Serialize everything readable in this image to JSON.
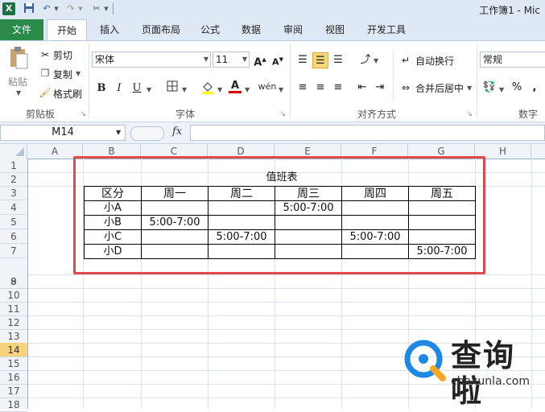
{
  "title_bar": {
    "window_title": "工作簿1 - Mic"
  },
  "tabs": [
    {
      "label": "文件"
    },
    {
      "label": "开始"
    },
    {
      "label": "插入"
    },
    {
      "label": "页面布局"
    },
    {
      "label": "公式"
    },
    {
      "label": "数据"
    },
    {
      "label": "审阅"
    },
    {
      "label": "视图"
    },
    {
      "label": "开发工具"
    }
  ],
  "ribbon": {
    "clipboard": {
      "paste": "粘贴",
      "cut": "剪切",
      "copy": "复制",
      "format_painter": "格式刷",
      "group_label": "剪贴板"
    },
    "font": {
      "font_name": "宋体",
      "font_size": "11",
      "bold": "B",
      "italic": "I",
      "underline": "U",
      "font_color_glyph": "A",
      "phonetic_glyph": "wén",
      "group_label": "字体"
    },
    "alignment": {
      "wrap_text": "自动换行",
      "merge_center": "合并后居中",
      "group_label": "对齐方式"
    },
    "number": {
      "format": "常规",
      "percent": "%",
      "comma": ",",
      "group_label": "数字"
    }
  },
  "formula_bar": {
    "name_box": "M14",
    "fx": "fx",
    "formula": ""
  },
  "sheet": {
    "columns": [
      "A",
      "B",
      "C",
      "D",
      "E",
      "F",
      "G",
      "H"
    ],
    "rows": [
      "1",
      "2",
      "3",
      "4",
      "5",
      "6",
      "7",
      "8",
      "9",
      "10",
      "11",
      "12",
      "13",
      "14",
      "15",
      "16",
      "17",
      "18"
    ],
    "selected_row": "14"
  },
  "duty_table": {
    "title": "值班表",
    "header": [
      "区分",
      "周一",
      "周二",
      "周三",
      "周四",
      "周五"
    ],
    "rows": [
      [
        "小A",
        "",
        "",
        "5:00-7:00",
        "",
        ""
      ],
      [
        "小B",
        "5:00-7:00",
        "",
        "",
        "",
        ""
      ],
      [
        "小C",
        "",
        "5:00-7:00",
        "",
        "5:00-7:00",
        ""
      ],
      [
        "小D",
        "",
        "",
        "",
        "",
        "5:00-7:00"
      ]
    ]
  },
  "watermark": {
    "brand": "查询啦",
    "domain": "chaxunla.com"
  },
  "colors": {
    "accent_green": "#2a8a4a",
    "highlight_red": "#e04a4a",
    "selected_row": "#f9d27c"
  }
}
